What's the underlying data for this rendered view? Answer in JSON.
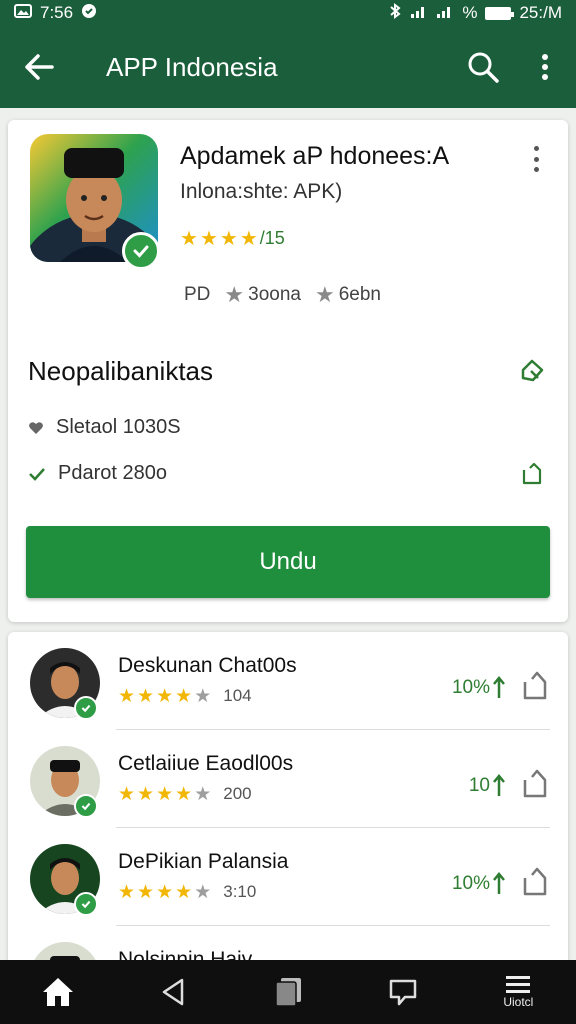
{
  "status_bar": {
    "time": "7:56",
    "right_text": "25:/M",
    "battery_label": "%"
  },
  "app_bar": {
    "title": "APP Indonesia"
  },
  "app": {
    "name": "Apdamek aP hdonees:A",
    "subtitle": "Inlona:shte: APK)",
    "rating": "/15",
    "stars": 4,
    "meta": [
      "PD",
      "3oona",
      "6ebn"
    ]
  },
  "section": {
    "title": "Neopalibaniktas",
    "row1": "Sletaol 1030S",
    "row2": "Pdarot 280o"
  },
  "download_label": "Undu",
  "list": [
    {
      "name": "Deskunan Chat00s",
      "stars": 4,
      "value": "104",
      "count": "10%"
    },
    {
      "name": "Cetlaiiue Eaodl00s",
      "stars": 4,
      "value": "200",
      "count": "10"
    },
    {
      "name": "DePikian Palansia",
      "stars": 4,
      "value": "3:10",
      "count": "10%"
    },
    {
      "name": "Nolsinnin Haiv"
    }
  ],
  "nav": {
    "menu_label": "Uiotcl"
  },
  "colors": {
    "primary": "#1b5e3b",
    "accent": "#1f8e3d",
    "star": "#f2b705"
  }
}
